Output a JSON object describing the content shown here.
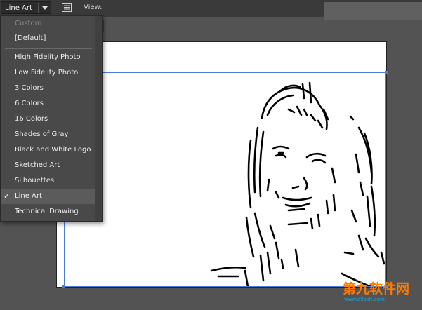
{
  "toolbar": {
    "preset_value": "Line Art",
    "view_label": "View:"
  },
  "preset_menu": {
    "items": [
      {
        "label": "Custom",
        "disabled": true
      },
      {
        "label": "[Default]"
      },
      {
        "label": "High Fidelity Photo"
      },
      {
        "label": "Low Fidelity Photo"
      },
      {
        "label": "3 Colors"
      },
      {
        "label": "6 Colors"
      },
      {
        "label": "16 Colors"
      },
      {
        "label": "Shades of Gray"
      },
      {
        "label": "Black and White Logo"
      },
      {
        "label": "Sketched Art"
      },
      {
        "label": "Silhouettes"
      },
      {
        "label": "Line Art",
        "checked": true
      },
      {
        "label": "Technical Drawing"
      }
    ],
    "check_glyph": "✓"
  },
  "watermark": {
    "main": "第九软件网",
    "sub": "www.d9soft.com"
  },
  "colors": {
    "selection": "#4a7cd6",
    "watermark_orange": "#ff7a00",
    "watermark_blue": "#1ba3e0"
  },
  "icons": [
    "chevron-down-icon",
    "panel-menu-icon",
    "checkmark-icon"
  ]
}
